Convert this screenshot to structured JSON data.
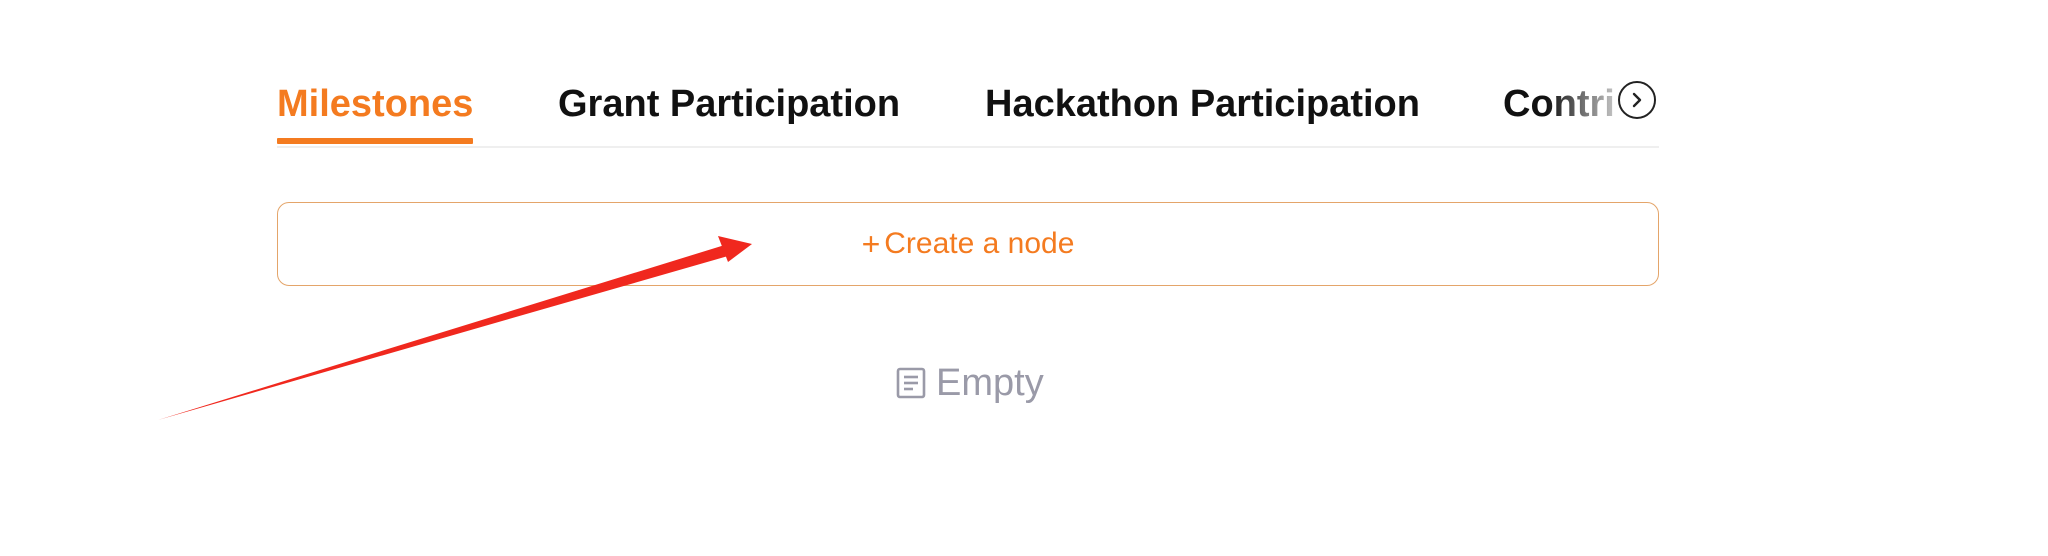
{
  "tabs": [
    {
      "label": "Milestones",
      "active": true
    },
    {
      "label": "Grant Participation",
      "active": false
    },
    {
      "label": "Hackathon Participation",
      "active": false
    },
    {
      "label": "Contributions",
      "active": false
    }
  ],
  "scroll_next_icon": "chevron-right-icon",
  "create_node": {
    "plus": "+",
    "label": "Create a node"
  },
  "empty_state": {
    "icon": "document-icon",
    "label": "Empty"
  },
  "colors": {
    "accent": "#f47b20",
    "create_border": "#e4a56a",
    "empty_text": "#9a9aa8",
    "annotation_arrow": "#f0281e"
  }
}
